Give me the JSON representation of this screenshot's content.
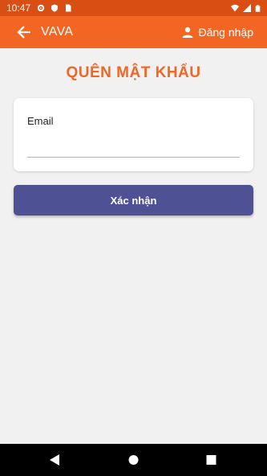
{
  "status_bar": {
    "time": "10:47",
    "icons": [
      "settings-icon",
      "shield-icon",
      "sim-card-icon",
      "wifi-icon",
      "signal-icon",
      "battery-icon"
    ]
  },
  "app_bar": {
    "title": "VAVA",
    "login_label": "Đăng nhập",
    "icons": [
      "back-arrow-icon",
      "person-icon"
    ]
  },
  "page": {
    "title": "QUÊN MẬT KHẨU"
  },
  "form": {
    "email_label": "Email",
    "email_value": "",
    "confirm_label": "Xác nhận"
  },
  "nav_bar": {
    "icons": [
      "back-triangle-icon",
      "home-circle-icon",
      "recents-square-icon"
    ]
  },
  "colors": {
    "status_bar": "#d94e12",
    "app_bar": "#f26522",
    "title": "#f26522",
    "button": "#4e5294",
    "background": "#f1f1f1"
  }
}
